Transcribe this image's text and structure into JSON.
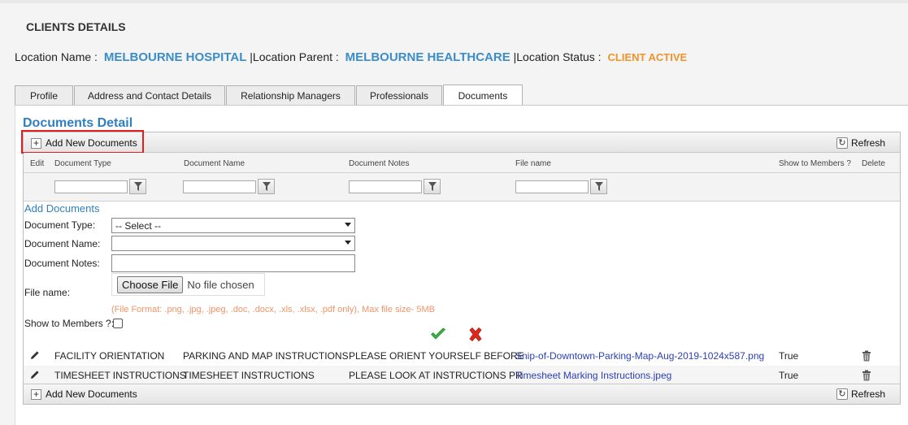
{
  "page": {
    "title": "CLIENTS DETAILS",
    "location_name_label": "Location Name :",
    "location_name": "MELBOURNE HOSPITAL",
    "location_parent_label": "|Location Parent :",
    "location_parent": "MELBOURNE HEALTHCARE",
    "location_status_label": "|Location Status :",
    "location_status": "CLIENT ACTIVE"
  },
  "tabs": [
    {
      "label": "Profile",
      "active": false
    },
    {
      "label": "Address and Contact Details",
      "active": false
    },
    {
      "label": "Relationship Managers",
      "active": false
    },
    {
      "label": "Professionals",
      "active": false
    },
    {
      "label": "Documents",
      "active": true
    }
  ],
  "documents": {
    "title": "Documents Detail",
    "add_button": "Add New Documents",
    "refresh_button": "Refresh",
    "columns": {
      "edit": "Edit",
      "type": "Document Type",
      "name": "Document Name",
      "notes": "Document Notes",
      "file": "File name",
      "show": "Show to Members ?",
      "delete": "Delete"
    },
    "filter_values": {
      "type": "",
      "name": "",
      "notes": "",
      "file": ""
    },
    "form": {
      "title": "Add Documents",
      "type_label": "Document Type:",
      "type_value": "-- Select --",
      "name_label": "Document Name:",
      "name_value": "",
      "notes_label": "Document Notes:",
      "notes_value": "",
      "file_label": "File name:",
      "choose_file": "Choose File",
      "no_file": "No file chosen",
      "file_hint": "(File Format: .png, .jpg, .jpeg, .doc, .docx, .xls, .xlsx, .pdf only), Max file size- 5MB",
      "show_label": "Show to Members ?:"
    },
    "rows": [
      {
        "type": "FACILITY ORIENTATION",
        "name": "PARKING AND MAP INSTRUCTIONS",
        "notes": "PLEASE ORIENT YOURSELF BEFORE",
        "file": "Snip-of-Downtown-Parking-Map-Aug-2019-1024x587.png",
        "show": "True"
      },
      {
        "type": "TIMESHEET INSTRUCTIONS",
        "name": "TIMESHEET INSTRUCTIONS",
        "notes": "PLEASE LOOK AT INSTRUCTIONS PR",
        "file": "Timesheet Marking Instructions.jpeg",
        "show": "True"
      }
    ]
  },
  "colors": {
    "accent": "#3a8dc8",
    "status": "#f0932b",
    "link": "#2b3fb5",
    "hint": "#f0956a",
    "highlight": "#e02020"
  }
}
